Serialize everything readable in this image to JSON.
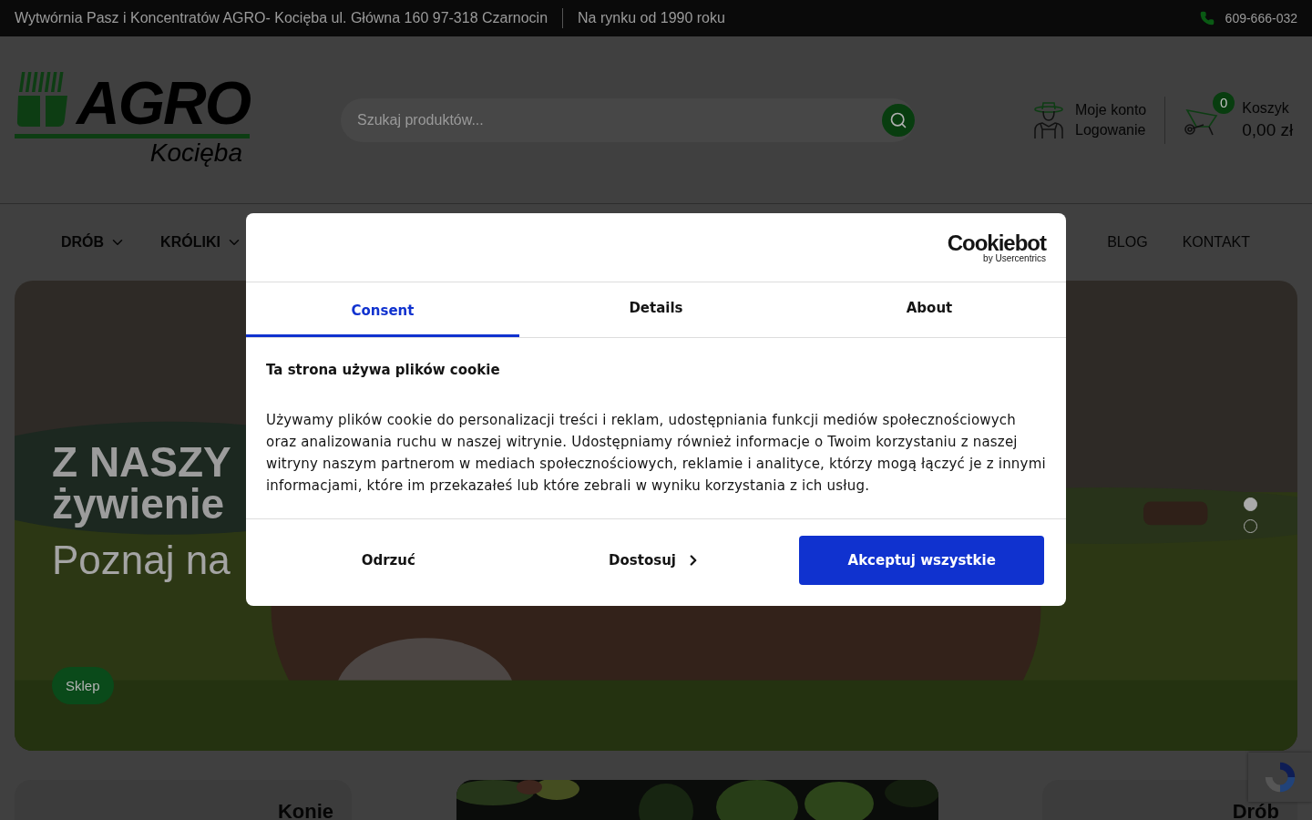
{
  "top_bar": {
    "address": "Wytwórnia Pasz i Koncentratów AGRO- Kocięba ul. Główna 160 97-318 Czarnocin",
    "slogan": "Na rynku od 1990 roku",
    "phone": "609-666-032"
  },
  "header": {
    "logo": {
      "name": "AGRO",
      "sub": "Kocięba"
    },
    "search": {
      "placeholder": "Szukaj produktów..."
    },
    "account": {
      "title": "Moje konto",
      "link": "Logowanie"
    },
    "cart": {
      "count": "0",
      "label": "Koszyk",
      "total": "0,00 zł"
    }
  },
  "nav": {
    "left": [
      {
        "label": "DRÓB",
        "has_dropdown": true
      },
      {
        "label": "KRÓLIKI",
        "has_dropdown": true
      }
    ],
    "right": [
      {
        "label": "BLOG",
        "has_dropdown": false
      },
      {
        "label": "KONTAKT",
        "has_dropdown": false
      }
    ]
  },
  "hero": {
    "title_lines": [
      "Z NASZY",
      "żywienie"
    ],
    "subtitle": "Poznaj na",
    "button": "Sklep",
    "dots": [
      {
        "selected": true
      },
      {
        "selected": false
      }
    ]
  },
  "categories": [
    {
      "kind": "tile",
      "title": "Konie"
    },
    {
      "kind": "picture"
    },
    {
      "kind": "tile",
      "title": "Drób"
    }
  ],
  "cookie_dialog": {
    "brand": "Cookiebot",
    "brand_sub": "by Usercentrics",
    "tabs": [
      {
        "label": "Consent",
        "selected": true
      },
      {
        "label": "Details",
        "selected": false
      },
      {
        "label": "About",
        "selected": false
      }
    ],
    "heading": "Ta strona używa plików cookie",
    "body": "Używamy plików cookie do personalizacji treści i reklam, udostępniania funkcji mediów społecznościowych oraz analizowania ruchu w naszej witrynie. Udostępniamy również informacje o Twoim korzystaniu z naszej witryny naszym partnerom w mediach społecznościowych, reklamie i analityce, którzy mogą łączyć je z innymi informacjami, które im przekazałeś lub które zebrali w wyniku korzystania z ich usług.",
    "buttons": [
      {
        "label": "Odrzuć",
        "kind": "plain"
      },
      {
        "label": "Dostosuj",
        "kind": "chevron"
      },
      {
        "label": "Akceptuj wszystkie",
        "kind": "primary"
      }
    ]
  }
}
